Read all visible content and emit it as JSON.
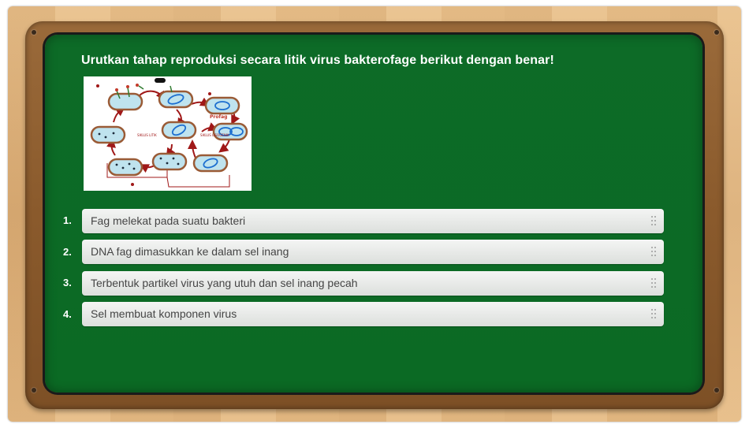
{
  "question": "Urutkan tahap reproduksi secara litik virus bakterofage berikut dengan benar!",
  "diagram": {
    "labels": {
      "lytic": "SIKLUS LITIK",
      "lysogenic": "SIKLUS LISOGENIK",
      "prophage": "Profag"
    }
  },
  "items": [
    {
      "number": "1.",
      "text": "Fag melekat pada suatu bakteri",
      "handle_icon": "drag-handle-icon"
    },
    {
      "number": "2.",
      "text": "DNA fag dimasukkan ke dalam sel inang",
      "handle_icon": "drag-handle-icon"
    },
    {
      "number": "3.",
      "text": "Terbentuk partikel virus yang utuh dan sel inang pecah",
      "handle_icon": "drag-handle-icon"
    },
    {
      "number": "4.",
      "text": "Sel membuat komponen virus",
      "handle_icon": "drag-handle-icon"
    }
  ],
  "colors": {
    "board": "#0b6a24",
    "frame": "#8a5a2c",
    "item_bg": "#e7e9e7",
    "item_text": "#454545"
  }
}
